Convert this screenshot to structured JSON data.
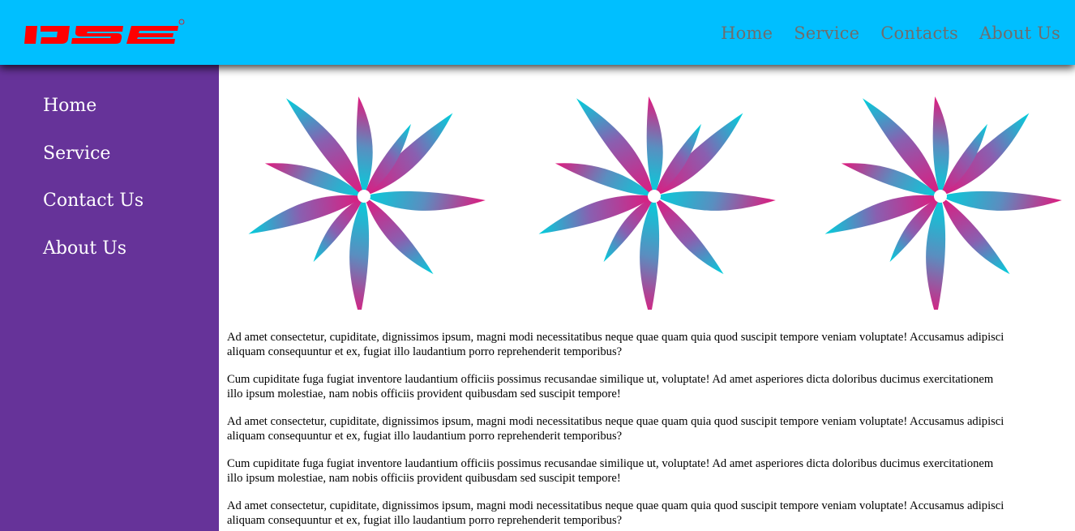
{
  "header": {
    "logo_text": "IJSE",
    "logo_color": "#ff0000",
    "background": "#00bfff",
    "nav": [
      {
        "label": "Home"
      },
      {
        "label": "Service"
      },
      {
        "label": "Contacts"
      },
      {
        "label": "About Us"
      }
    ]
  },
  "sidebar": {
    "background": "#663399",
    "items": [
      {
        "label": "Home"
      },
      {
        "label": "Service"
      },
      {
        "label": "Contact Us"
      },
      {
        "label": "About Us"
      }
    ]
  },
  "gallery": {
    "images": [
      {
        "icon": "flower-logo-icon"
      },
      {
        "icon": "flower-logo-icon"
      },
      {
        "icon": "flower-logo-icon"
      }
    ],
    "colors": {
      "pink": "#e0197d",
      "cyan": "#00d0dc"
    }
  },
  "content": {
    "paragraphs": [
      {
        "line1": "Ad amet consectetur, cupiditate, dignissimos ipsum, magni modi necessitatibus neque quae quam quia quod suscipit tempore veniam voluptate! Accusamus adipisci",
        "line2": "aliquam consequuntur et ex, fugiat illo laudantium porro reprehenderit temporibus?"
      },
      {
        "line1": "Cum cupiditate fuga fugiat inventore laudantium officiis possimus recusandae similique ut, voluptate! Ad amet asperiores dicta doloribus ducimus exercitationem",
        "line2": "illo ipsum molestiae, nam nobis officiis provident quibusdam sed suscipit tempore!"
      },
      {
        "line1": "Ad amet consectetur, cupiditate, dignissimos ipsum, magni modi necessitatibus neque quae quam quia quod suscipit tempore veniam voluptate! Accusamus adipisci",
        "line2": "aliquam consequuntur et ex, fugiat illo laudantium porro reprehenderit temporibus?"
      },
      {
        "line1": "Cum cupiditate fuga fugiat inventore laudantium officiis possimus recusandae similique ut, voluptate! Ad amet asperiores dicta doloribus ducimus exercitationem",
        "line2": "illo ipsum molestiae, nam nobis officiis provident quibusdam sed suscipit tempore!"
      },
      {
        "line1": "Ad amet consectetur, cupiditate, dignissimos ipsum, magni modi necessitatibus neque quae quam quia quod suscipit tempore veniam voluptate! Accusamus adipisci",
        "line2": "aliquam consequuntur et ex, fugiat illo laudantium porro reprehenderit temporibus?"
      }
    ]
  }
}
